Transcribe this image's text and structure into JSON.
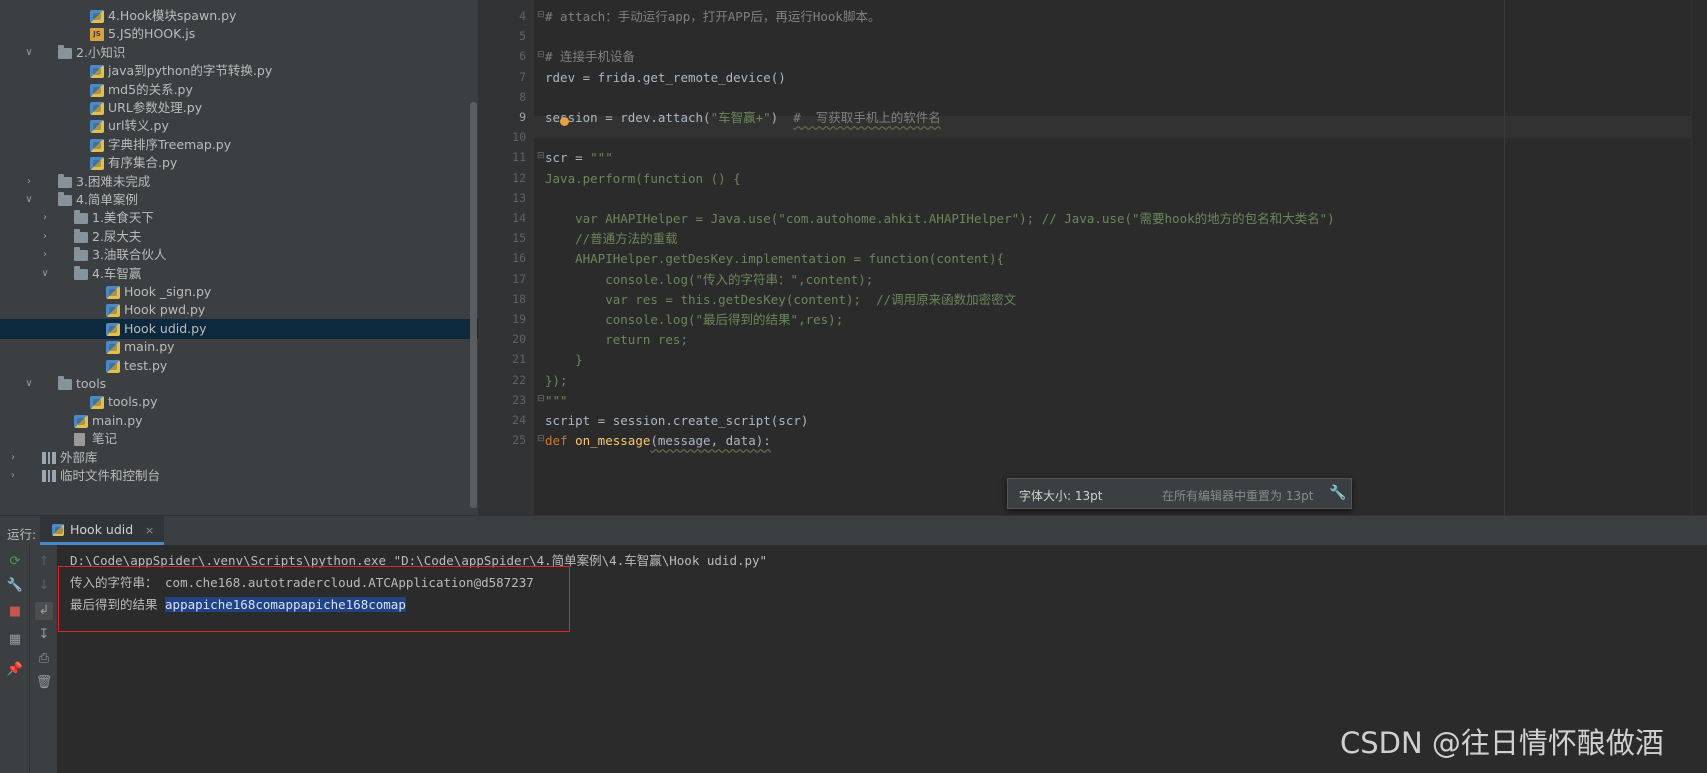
{
  "project_tree": [
    {
      "indent": 3,
      "arrow": "",
      "icon": "py",
      "label": "4.Hook模块spawn.py"
    },
    {
      "indent": 3,
      "arrow": "",
      "icon": "js",
      "label": "5.JS的HOOK.js"
    },
    {
      "indent": 1,
      "arrow": "v",
      "icon": "folder",
      "label": "2.小知识"
    },
    {
      "indent": 3,
      "arrow": "",
      "icon": "py",
      "label": "java到python的字节转换.py"
    },
    {
      "indent": 3,
      "arrow": "",
      "icon": "py",
      "label": "md5的关系.py"
    },
    {
      "indent": 3,
      "arrow": "",
      "icon": "py",
      "label": "URL参数处理.py"
    },
    {
      "indent": 3,
      "arrow": "",
      "icon": "py",
      "label": "url转义.py"
    },
    {
      "indent": 3,
      "arrow": "",
      "icon": "py",
      "label": "字典排序Treemap.py"
    },
    {
      "indent": 3,
      "arrow": "",
      "icon": "py",
      "label": "有序集合.py"
    },
    {
      "indent": 1,
      "arrow": ">",
      "icon": "folder",
      "label": "3.困难未完成"
    },
    {
      "indent": 1,
      "arrow": "v",
      "icon": "folder",
      "label": "4.简单案例"
    },
    {
      "indent": 2,
      "arrow": ">",
      "icon": "folder",
      "label": "1.美食天下"
    },
    {
      "indent": 2,
      "arrow": ">",
      "icon": "folder",
      "label": "2.尿大夫"
    },
    {
      "indent": 2,
      "arrow": ">",
      "icon": "folder",
      "label": "3.油联合伙人"
    },
    {
      "indent": 2,
      "arrow": "v",
      "icon": "folder",
      "label": "4.车智赢"
    },
    {
      "indent": 4,
      "arrow": "",
      "icon": "py",
      "label": "Hook _sign.py"
    },
    {
      "indent": 4,
      "arrow": "",
      "icon": "py",
      "label": "Hook pwd.py"
    },
    {
      "indent": 4,
      "arrow": "",
      "icon": "py",
      "label": "Hook udid.py",
      "selected": true
    },
    {
      "indent": 4,
      "arrow": "",
      "icon": "py",
      "label": "main.py"
    },
    {
      "indent": 4,
      "arrow": "",
      "icon": "py",
      "label": "test.py"
    },
    {
      "indent": 1,
      "arrow": "v",
      "icon": "folder",
      "label": "tools"
    },
    {
      "indent": 3,
      "arrow": "",
      "icon": "py",
      "label": "tools.py"
    },
    {
      "indent": 2,
      "arrow": "",
      "icon": "py",
      "label": "main.py"
    },
    {
      "indent": 2,
      "arrow": "",
      "icon": "note",
      "label": "笔记"
    },
    {
      "indent": 0,
      "arrow": ">",
      "icon": "lib",
      "label": "外部库"
    },
    {
      "indent": 0,
      "arrow": ">",
      "icon": "lib",
      "label": "临时文件和控制台"
    }
  ],
  "editor": {
    "current_line": 9,
    "lines": [
      {
        "n": 4,
        "fold": true,
        "segs": [
          {
            "t": "# attach：手动运行app，打开APP后，再运行Hook脚本。",
            "c": "com"
          }
        ]
      },
      {
        "n": 5,
        "segs": []
      },
      {
        "n": 6,
        "fold": true,
        "segs": [
          {
            "t": "# 连接手机设备",
            "c": "com"
          }
        ]
      },
      {
        "n": 7,
        "segs": [
          {
            "t": "rdev = frida.get_remote_device()",
            "c": ""
          }
        ]
      },
      {
        "n": 8,
        "segs": []
      },
      {
        "n": 9,
        "segs": [
          {
            "t": "session = rdev.attach(",
            "c": ""
          },
          {
            "t": "\"车智赢+\"",
            "c": "str"
          },
          {
            "t": ")  ",
            "c": ""
          },
          {
            "t": "#  写获取手机上的软件名",
            "c": "com wavy"
          }
        ]
      },
      {
        "n": 10,
        "segs": []
      },
      {
        "n": 11,
        "fold": true,
        "segs": [
          {
            "t": "scr = ",
            "c": ""
          },
          {
            "t": "\"\"\"",
            "c": "str"
          }
        ]
      },
      {
        "n": 12,
        "segs": [
          {
            "t": "Java.perform(function () {",
            "c": "str"
          }
        ]
      },
      {
        "n": 13,
        "segs": []
      },
      {
        "n": 14,
        "segs": [
          {
            "t": "    var AHAPIHelper = Java.use(\"com.autohome.ahkit.AHAPIHelper\"); // Java.use(\"需要hook的地方的包名和大类名\")",
            "c": "str"
          }
        ]
      },
      {
        "n": 15,
        "segs": [
          {
            "t": "    //普通方法的重载",
            "c": "str"
          }
        ]
      },
      {
        "n": 16,
        "segs": [
          {
            "t": "    AHAPIHelper.getDesKey.implementation = function(content){",
            "c": "str"
          }
        ]
      },
      {
        "n": 17,
        "segs": [
          {
            "t": "        console.log(\"传入的字符串：\",content);",
            "c": "str"
          }
        ]
      },
      {
        "n": 18,
        "segs": [
          {
            "t": "        var res = this.getDesKey(content);  //调用原来函数加密密文",
            "c": "str"
          }
        ]
      },
      {
        "n": 19,
        "segs": [
          {
            "t": "        console.log(\"最后得到的结果\",res);",
            "c": "str"
          }
        ]
      },
      {
        "n": 20,
        "segs": [
          {
            "t": "        return res;",
            "c": "str"
          }
        ]
      },
      {
        "n": 21,
        "segs": [
          {
            "t": "    }",
            "c": "str"
          }
        ]
      },
      {
        "n": 22,
        "segs": [
          {
            "t": "});",
            "c": "str"
          }
        ]
      },
      {
        "n": 23,
        "fold": true,
        "segs": [
          {
            "t": "\"\"\"",
            "c": "str"
          }
        ]
      },
      {
        "n": 24,
        "segs": [
          {
            "t": "script = session.create_script(scr)",
            "c": ""
          }
        ]
      },
      {
        "n": 25,
        "fold": true,
        "segs": [
          {
            "t": "def ",
            "c": "kw"
          },
          {
            "t": "on_message",
            "c": "fn"
          },
          {
            "t": "(message, data):",
            "c": "wavy"
          }
        ]
      }
    ]
  },
  "font_popup": {
    "label": "字体大小: 13pt",
    "reset": "在所有编辑器中重置为 13pt",
    "icon": "wrench-icon"
  },
  "run": {
    "label": "运行:",
    "tab": "Hook udid",
    "tab_close": "×"
  },
  "console": {
    "command": "D:\\Code\\appSpider\\.venv\\Scripts\\python.exe \"D:\\Code\\appSpider\\4.简单案例\\4.车智赢\\Hook udid.py\"",
    "line1_label": "传入的字符串： ",
    "line1_value": "com.che168.autotradercloud.ATCApplication@d587237",
    "line2_label": "最后得到的结果 ",
    "line2_value": "appapiche168comappapiche168comap"
  },
  "watermark": "CSDN @往日情怀酿做酒",
  "colors": {
    "highlight_box": "#e0262b",
    "selection": "#214283",
    "accent": "#4a88c7"
  }
}
